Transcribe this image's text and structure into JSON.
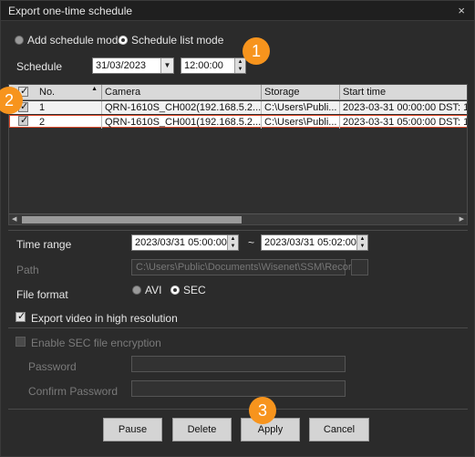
{
  "window": {
    "title": "Export one-time schedule",
    "close_glyph": "×"
  },
  "mode": {
    "add_label": "Add schedule mode",
    "list_label": "Schedule list mode",
    "selected": "list"
  },
  "schedule": {
    "label": "Schedule",
    "date": "31/03/2023",
    "time": "12:00:00"
  },
  "badges": [
    "1",
    "2",
    "3"
  ],
  "table": {
    "columns": [
      "No.",
      "Camera",
      "Storage",
      "Start time"
    ],
    "rows": [
      {
        "no": "1",
        "camera": "QRN-1610S_CH002(192.168.5.2...",
        "storage": "C:\\Users\\Publi...",
        "start": "2023-03-31 00:00:00 DST: 1",
        "checked": true
      },
      {
        "no": "2",
        "camera": "QRN-1610S_CH001(192.168.5.2...",
        "storage": "C:\\Users\\Publi...",
        "start": "2023-03-31 05:00:00 DST: 1",
        "checked": true
      }
    ]
  },
  "time_range": {
    "label": "Time range",
    "from": "2023/03/31 05:00:00",
    "sep": "~",
    "to": "2023/03/31 05:02:00"
  },
  "path": {
    "label": "Path",
    "value": "C:\\Users\\Public\\Documents\\Wisenet\\SSM\\Record"
  },
  "file_format": {
    "label": "File format",
    "avi": "AVI",
    "sec": "SEC",
    "selected": "SEC"
  },
  "export_hires": {
    "label": "Export video in high resolution",
    "checked": true
  },
  "sec_encryption": {
    "label": "Enable SEC file encryption",
    "checked": false
  },
  "password": {
    "label": "Password",
    "value": ""
  },
  "confirm_password": {
    "label": "Confirm Password",
    "value": ""
  },
  "buttons": {
    "pause": "Pause",
    "delete": "Delete",
    "apply": "Apply",
    "cancel": "Cancel"
  },
  "colors": {
    "badge": "#f7941d",
    "selected_row_border": "#e14a2a"
  }
}
